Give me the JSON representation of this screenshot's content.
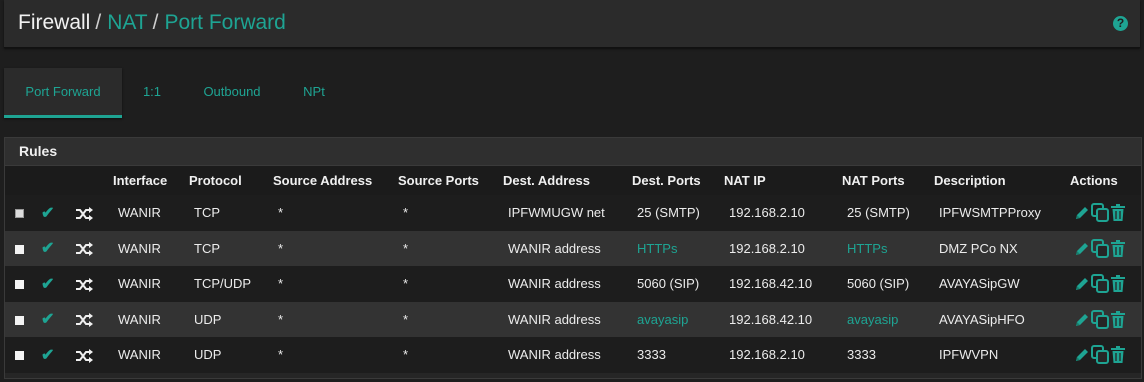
{
  "breadcrumb": {
    "firewall": "Firewall",
    "nat": "NAT",
    "port_forward": "Port Forward",
    "sep": "/"
  },
  "help_icon": "?",
  "tabs": [
    {
      "label": "Port Forward",
      "active": true
    },
    {
      "label": "1:1",
      "active": false
    },
    {
      "label": "Outbound",
      "active": false
    },
    {
      "label": "NPt",
      "active": false
    }
  ],
  "panel": {
    "title": "Rules"
  },
  "columns": [
    "Interface",
    "Protocol",
    "Source Address",
    "Source Ports",
    "Dest. Address",
    "Dest. Ports",
    "NAT IP",
    "NAT Ports",
    "Description",
    "Actions"
  ],
  "rows": [
    {
      "interface": "WANIR",
      "protocol": "TCP",
      "src_addr": "*",
      "src_ports": "*",
      "dst_addr": "IPFWMUGW net",
      "dst_ports": "25 (SMTP)",
      "nat_ip": "192.168.2.10",
      "nat_ports": "25 (SMTP)",
      "description": "IPFWSMTPProxy"
    },
    {
      "interface": "WANIR",
      "protocol": "TCP",
      "src_addr": "*",
      "src_ports": "*",
      "dst_addr": "WANIR address",
      "dst_ports": "HTTPs",
      "nat_ip": "192.168.2.10",
      "nat_ports": "HTTPs",
      "description": "DMZ PCo NX"
    },
    {
      "interface": "WANIR",
      "protocol": "TCP/UDP",
      "src_addr": "*",
      "src_ports": "*",
      "dst_addr": "WANIR address",
      "dst_ports": "5060 (SIP)",
      "nat_ip": "192.168.42.10",
      "nat_ports": "5060 (SIP)",
      "description": "AVAYASipGW"
    },
    {
      "interface": "WANIR",
      "protocol": "UDP",
      "src_addr": "*",
      "src_ports": "*",
      "dst_addr": "WANIR address",
      "dst_ports": "avayasip",
      "nat_ip": "192.168.42.10",
      "nat_ports": "avayasip",
      "description": "AVAYASipHFO"
    },
    {
      "interface": "WANIR",
      "protocol": "UDP",
      "src_addr": "*",
      "src_ports": "*",
      "dst_addr": "WANIR address",
      "dst_ports": "3333",
      "nat_ip": "192.168.2.10",
      "nat_ports": "3333",
      "description": "IPFWVPN"
    }
  ],
  "link_cells": [
    [
      1,
      "dst_ports"
    ],
    [
      1,
      "nat_ports"
    ],
    [
      3,
      "dst_ports"
    ],
    [
      3,
      "nat_ports"
    ]
  ],
  "colors": {
    "accent": "#1ea493",
    "background": "#1e1e1e",
    "panel": "#262626"
  }
}
